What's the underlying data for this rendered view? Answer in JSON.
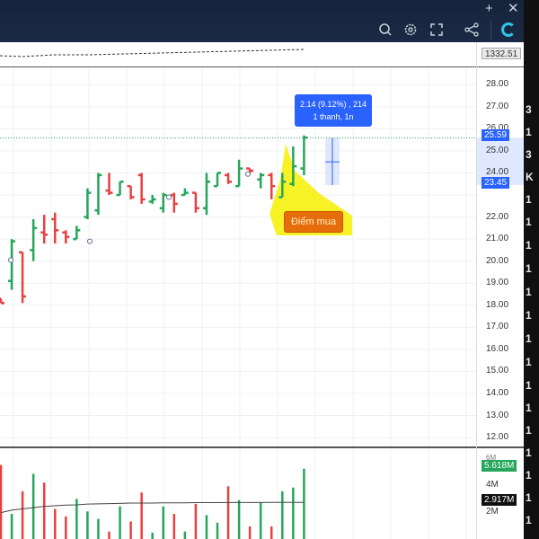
{
  "toolbar": {
    "plus_icon": "plus-icon",
    "close_icon": "close-icon",
    "compare_value_partial": "1332.51"
  },
  "price_axis": {
    "labels": [
      "28.00",
      "27.00",
      "26.00",
      "25.00",
      "24.00",
      "22.00",
      "21.00",
      "20.00",
      "19.00",
      "18.00",
      "17.00",
      "16.00",
      "15.00",
      "14.00",
      "13.00",
      "12.00"
    ],
    "current_price": "25.59",
    "range_low": "23.45"
  },
  "volume_axis": {
    "labels": [
      "4M",
      "2M"
    ],
    "top_label": "6M",
    "last_volume": "5.618M",
    "avg_volume": "2.917M"
  },
  "measure_tooltip": {
    "line1": "2.14 (9.12%) , 214",
    "line2": "1 thanh, 1n"
  },
  "callout_label": "Điểm mua",
  "right_panel": {
    "items": [
      "3",
      "1",
      "3",
      "K",
      "1",
      "1",
      "1",
      "1",
      "1",
      "1",
      "1",
      "1",
      "1",
      "1",
      "1",
      "1",
      "1",
      "1",
      "1",
      "1",
      "1"
    ]
  },
  "colors": {
    "up": "#26a65b",
    "down": "#e84040",
    "blue": "#2962ff",
    "orange": "#e76c0c",
    "highlight": "#f6f000"
  },
  "chart_data": {
    "type": "bar",
    "series": [
      {
        "o": 18.3,
        "h": 18.3,
        "l": 18.1,
        "c": 18.1
      },
      {
        "o": 19.1,
        "h": 21.0,
        "l": 18.7,
        "c": 20.9
      },
      {
        "o": 20.4,
        "h": 20.4,
        "l": 18.1,
        "c": 18.4
      },
      {
        "o": 20.5,
        "h": 21.9,
        "l": 20.0,
        "c": 21.5
      },
      {
        "o": 21.3,
        "h": 22.1,
        "l": 20.8,
        "c": 21.2
      },
      {
        "o": 21.9,
        "h": 22.2,
        "l": 20.8,
        "c": 21.4
      },
      {
        "o": 21.3,
        "h": 21.4,
        "l": 20.8,
        "c": 21.1
      },
      {
        "o": 21.0,
        "h": 21.6,
        "l": 21.0,
        "c": 21.4
      },
      {
        "o": 22.0,
        "h": 23.3,
        "l": 21.9,
        "c": 23.1
      },
      {
        "o": 22.3,
        "h": 24.0,
        "l": 22.1,
        "c": 23.9
      },
      {
        "o": 23.2,
        "h": 24.0,
        "l": 23.0,
        "c": 23.1
      },
      {
        "o": 23.0,
        "h": 23.6,
        "l": 23.0,
        "c": 23.6
      },
      {
        "o": 23.4,
        "h": 23.4,
        "l": 22.8,
        "c": 22.9
      },
      {
        "o": 23.9,
        "h": 24.0,
        "l": 22.6,
        "c": 22.8
      },
      {
        "o": 22.7,
        "h": 23.0,
        "l": 22.6,
        "c": 22.8
      },
      {
        "o": 22.4,
        "h": 23.1,
        "l": 22.2,
        "c": 23.0
      },
      {
        "o": 23.0,
        "h": 23.1,
        "l": 22.2,
        "c": 22.6
      },
      {
        "o": 23.0,
        "h": 23.3,
        "l": 23.0,
        "c": 23.1
      },
      {
        "o": 23.1,
        "h": 23.1,
        "l": 22.2,
        "c": 22.4
      },
      {
        "o": 22.4,
        "h": 24.0,
        "l": 22.1,
        "c": 23.6
      },
      {
        "o": 23.4,
        "h": 24.0,
        "l": 23.4,
        "c": 24.0
      },
      {
        "o": 23.9,
        "h": 24.0,
        "l": 23.5,
        "c": 23.6
      },
      {
        "o": 23.4,
        "h": 24.6,
        "l": 23.4,
        "c": 24.2
      },
      {
        "o": 24.2,
        "h": 24.2,
        "l": 24.0,
        "c": 24.1
      },
      {
        "o": 23.7,
        "h": 24.0,
        "l": 23.3,
        "c": 23.9
      },
      {
        "o": 23.9,
        "h": 24.0,
        "l": 22.8,
        "c": 23.4
      },
      {
        "o": 22.9,
        "h": 24.0,
        "l": 22.9,
        "c": 23.6
      },
      {
        "o": 23.5,
        "h": 25.2,
        "l": 23.4,
        "c": 24.3
      },
      {
        "o": 24.2,
        "h": 25.7,
        "l": 23.9,
        "c": 25.6
      }
    ],
    "volume_millions": [
      5.9,
      2.0,
      3.8,
      5.2,
      4.5,
      2.4,
      1.8,
      3.2,
      2.2,
      1.6,
      0.6,
      2.6,
      1.4,
      3.7,
      0.5,
      2.6,
      2.0,
      0.6,
      2.8,
      1.9,
      1.3,
      4.2,
      3.1,
      1.0,
      2.9,
      1.0,
      3.8,
      4.1,
      5.6
    ],
    "avg_volume_line": [
      2.1,
      2.3,
      2.4,
      2.5,
      2.6,
      2.65,
      2.7,
      2.72,
      2.78,
      2.8,
      2.82,
      2.84,
      2.86,
      2.86,
      2.86,
      2.88,
      2.88,
      2.88,
      2.9,
      2.9,
      2.9,
      2.91,
      2.91,
      2.91,
      2.91,
      2.92,
      2.92,
      2.92,
      2.92
    ],
    "ylim": [
      11.8,
      28.5
    ],
    "volume_ylim": [
      0,
      6.8
    ]
  }
}
